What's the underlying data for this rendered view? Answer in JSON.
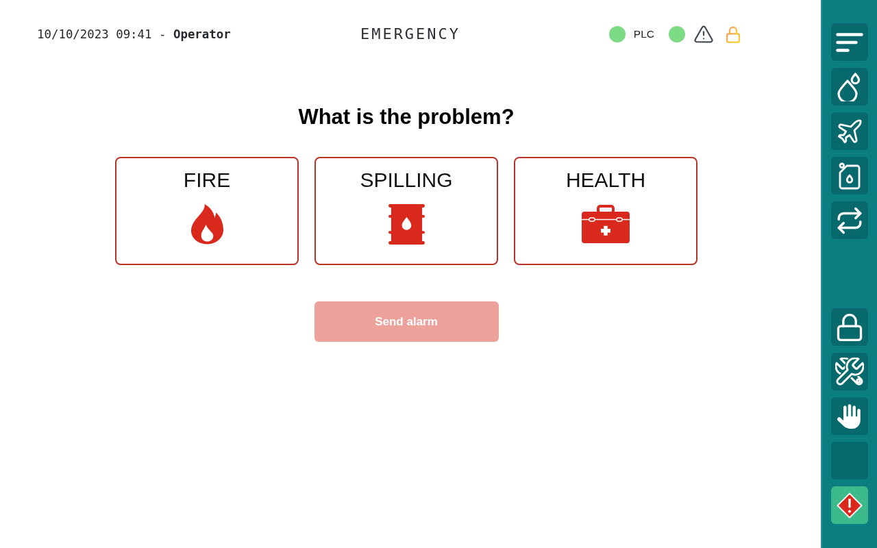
{
  "header": {
    "datetime_user": "10/10/2023 09:41 - **Operator**",
    "title": "EMERGENCY",
    "status": [
      {
        "kind": "dot",
        "color": "#7dda85",
        "label": "PLC"
      },
      {
        "kind": "dot",
        "color": "#7dda85"
      },
      {
        "kind": "warning"
      },
      {
        "kind": "lock"
      }
    ]
  },
  "question": "What is the problem?",
  "options": [
    {
      "label": "FIRE",
      "selected": false
    },
    {
      "label": "SPILLING",
      "selected": false
    },
    {
      "label": "HEALTH",
      "selected": false
    }
  ],
  "send_button": {
    "label": "Send alarm",
    "disabled": true
  },
  "sidebar": {
    "top_items": [
      {
        "selected": false
      },
      {
        "selected": false
      },
      {
        "selected": false
      },
      {
        "selected": false
      },
      {
        "selected": false
      }
    ],
    "bottom_items": [
      {
        "selected": false
      },
      {
        "selected": false
      },
      {
        "selected": false
      },
      {
        "selected": false
      },
      {
        "selected": true
      }
    ]
  }
}
